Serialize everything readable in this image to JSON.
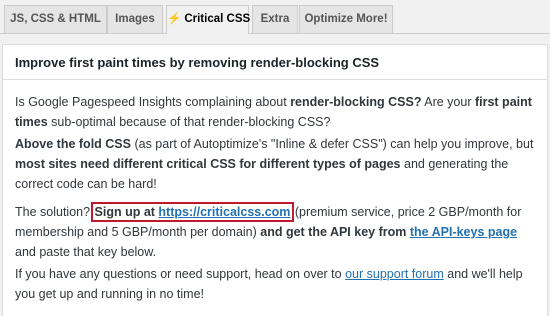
{
  "tabs": [
    {
      "label": "JS, CSS & HTML"
    },
    {
      "label": "Images"
    },
    {
      "icon": "⚡",
      "label": "Critical CSS",
      "active": true
    },
    {
      "label": "Extra"
    },
    {
      "label": "Optimize More!"
    }
  ],
  "panel": {
    "heading": "Improve first paint times by removing render-blocking CSS",
    "p1": {
      "t1": "Is Google Pagespeed Insights complaining about ",
      "b1": "render-blocking CSS?",
      "t2": " Are your ",
      "b2": "first paint times",
      "t3": " sub-optimal because of that render-blocking CSS?"
    },
    "p2": {
      "b1": "Above the fold CSS",
      "t1": " (as part of Autoptimize's \"Inline & defer CSS\") can help you improve, but ",
      "b2": "most sites need different critical CSS for different types of pages",
      "t2": " and generating the correct code can be hard!"
    },
    "p3": {
      "t1": "The solution? ",
      "b1": "Sign up at ",
      "link1": "https://criticalcss.com",
      "t2": " (premium service, price 2 GBP/month for membership and 5 GBP/month per domain) ",
      "b2": "and get the API key from ",
      "link2": "the API-keys page",
      "t3": " and paste that key below."
    },
    "p4": {
      "t1": "If you have any questions or need support, head on over to ",
      "link1": "our support forum",
      "t2": " and we'll help you get up and running in no time!"
    }
  },
  "colors": {
    "link": "#2271b1",
    "highlight_box": "#c0182c",
    "page_bg": "#f1f1f1",
    "panel_bg": "#ffffff"
  }
}
